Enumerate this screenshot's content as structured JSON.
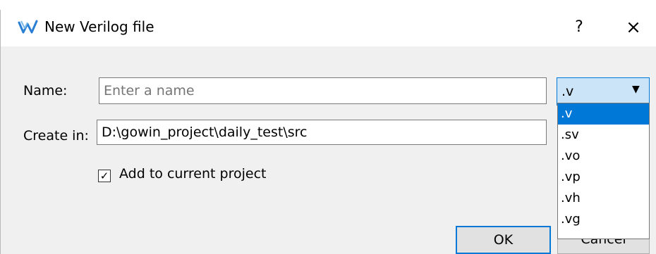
{
  "dialog": {
    "title": "New Verilog file",
    "help_label": "?",
    "close_label": "×"
  },
  "form": {
    "name_label": "Name:",
    "name_placeholder": "Enter a name",
    "name_value": "",
    "create_in_label": "Create in:",
    "create_in_value": "D:\\gowin_project\\daily_test\\src",
    "extension_selected": ".v",
    "extension_options": [
      ".v",
      ".sv",
      ".vo",
      ".vp",
      ".vh",
      ".vg"
    ],
    "add_to_project_label": "Add to current project",
    "add_to_project_checked": true,
    "checkbox_mark": "✓"
  },
  "buttons": {
    "ok_label": "OK",
    "cancel_label": "Cancel"
  },
  "colors": {
    "accent": "#0078d7",
    "select_bg": "#cce4f7",
    "dialog_bg": "#f0f0f0"
  },
  "icons": {
    "app": "gowin-logo-icon",
    "dropdown": "chevron-down-icon"
  }
}
